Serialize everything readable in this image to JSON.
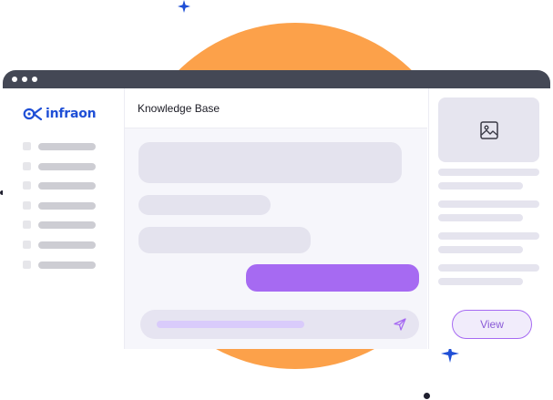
{
  "brand": {
    "name": "infraon",
    "color": "#1f4fd6"
  },
  "chat": {
    "title": "Knowledge Base",
    "send_icon": "paper-plane-icon"
  },
  "panel": {
    "image_icon": "image-icon",
    "view_button_label": "View"
  },
  "colors": {
    "accent": "#a66af2",
    "backdrop_circle": "#fca14a",
    "titlebar": "#444855"
  }
}
